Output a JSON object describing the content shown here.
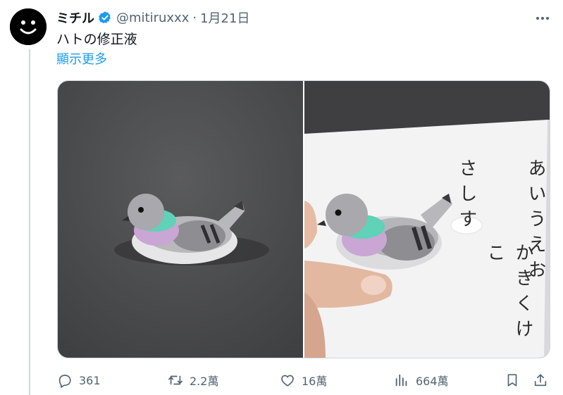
{
  "post": {
    "author_name": "ミチル",
    "handle": "@mitiruxxx",
    "separator": "·",
    "date": "1月21日",
    "text": "ハトの修正液",
    "show_more": "顯示更多"
  },
  "media": {
    "right_note_lines": [
      "あいうえお",
      "かきくけこ",
      "さしす"
    ]
  },
  "actions": {
    "replies": "361",
    "reposts": "2.2萬",
    "likes": "16萬",
    "views": "664萬"
  },
  "colors": {
    "accent": "#1d9bf0",
    "muted_text": "#536471",
    "verified_badge": "#1d9bf0"
  },
  "icons": [
    "smiley-avatar-icon",
    "verified-badge-icon",
    "more-options-icon",
    "reply-icon",
    "repost-icon",
    "like-icon",
    "views-icon",
    "bookmark-icon",
    "share-icon"
  ]
}
